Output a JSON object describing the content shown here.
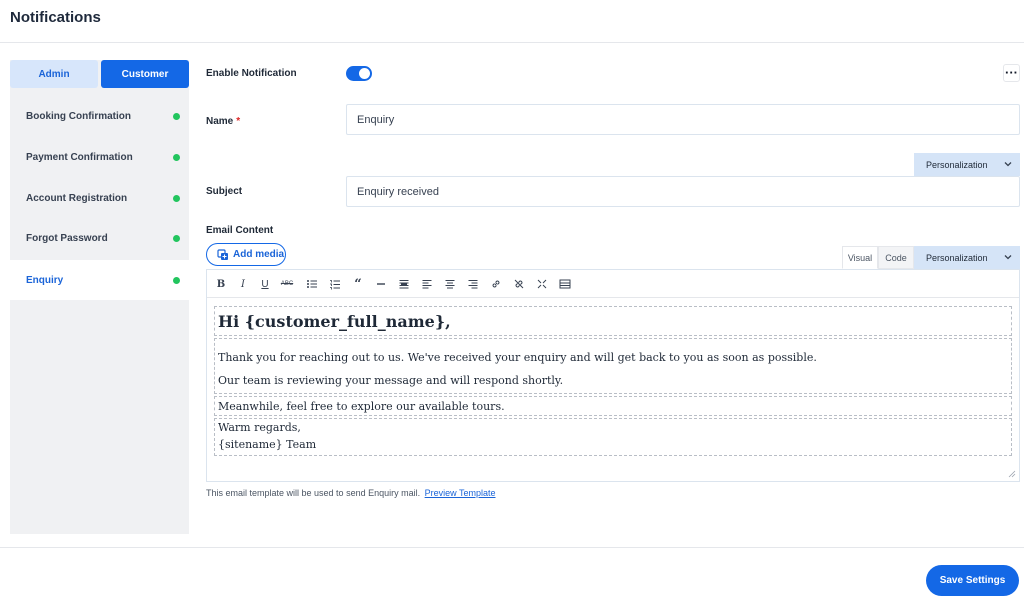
{
  "header": {
    "title": "Notifications"
  },
  "sidebar": {
    "tabs": {
      "admin": "Admin",
      "customer": "Customer"
    },
    "items": [
      {
        "label": "Booking Confirmation",
        "status_color": "#22c55e"
      },
      {
        "label": "Payment Confirmation",
        "status_color": "#22c55e"
      },
      {
        "label": "Account Registration",
        "status_color": "#22c55e"
      },
      {
        "label": "Forgot Password",
        "status_color": "#22c55e"
      },
      {
        "label": "Enquiry",
        "status_color": "#22c55e",
        "active": true
      }
    ]
  },
  "form": {
    "enable_label": "Enable Notification",
    "enable_on": true,
    "more_icon": "more-horizontal-icon",
    "name_label": "Name",
    "name_required": "*",
    "name_value": "Enquiry",
    "personalization_label": "Personalization",
    "subject_label": "Subject",
    "subject_value": "Enquiry received",
    "email_content_label": "Email Content",
    "add_media_label": "Add media",
    "editor_tabs": {
      "visual": "Visual",
      "code": "Code"
    },
    "editor_personalization_label": "Personalization",
    "toolbar": [
      "bold-icon",
      "italic-icon",
      "underline-icon",
      "strikethrough-icon",
      "bullet-list-icon",
      "numbered-list-icon",
      "blockquote-icon",
      "horizontal-rule-icon",
      "align-justify-icon",
      "align-left-icon",
      "align-center-icon",
      "align-right-icon",
      "link-icon",
      "unlink-icon",
      "fullscreen-icon",
      "toolbar-toggle-icon"
    ],
    "email_body": {
      "greeting": "Hi {customer_full_name},",
      "line1": "Thank you for reaching out to us. We've received your enquiry and will get back to you as soon as possible.",
      "line2": "Our team is reviewing your message and will respond shortly.",
      "line3": "Meanwhile, feel free to explore our available tours.",
      "line4": "Warm regards,",
      "line5": "{sitename} Team"
    },
    "note_text": "This email template will be used to send Enquiry mail.",
    "preview_link": "Preview Template"
  },
  "footer": {
    "save_label": "Save Settings"
  },
  "colors": {
    "accent": "#1468e6",
    "status_green": "#22c55e"
  }
}
